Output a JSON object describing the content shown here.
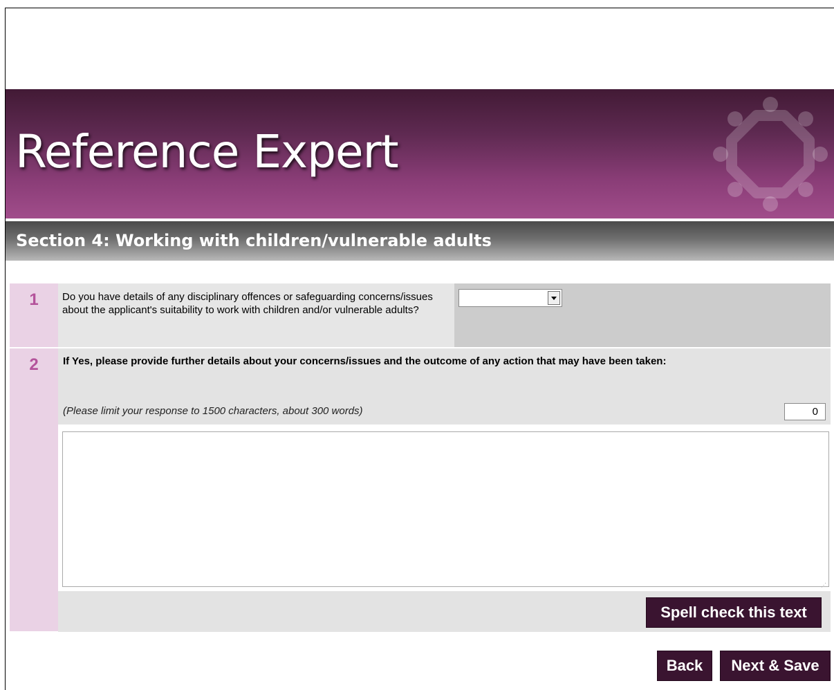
{
  "header": {
    "app_title": "Reference Expert",
    "logo_icon": "circular-people-emblem-icon"
  },
  "section": {
    "title": "Section 4: Working with children/vulnerable adults"
  },
  "questions": [
    {
      "number": "1",
      "text": "Do you have details of any disciplinary offences or safeguarding concerns/issues about the applicant's suitability to work with children and/or vulnerable adults?",
      "answer_value": ""
    },
    {
      "number": "2",
      "text": "If Yes, please provide further details about your concerns/issues and the outcome of any action that may have been taken:",
      "hint": "(Please limit your response to 1500 characters, about 300 words)",
      "char_count": "0",
      "response_value": "",
      "spell_check_label": "Spell check this text"
    }
  ],
  "navigation": {
    "back_label": "Back",
    "next_label": "Next & Save"
  },
  "colors": {
    "banner_dark": "#421a35",
    "banner_light": "#a14d8b",
    "accent_number": "#b4539b",
    "number_column": "#ead2e5",
    "button_bg": "#3a1430"
  }
}
